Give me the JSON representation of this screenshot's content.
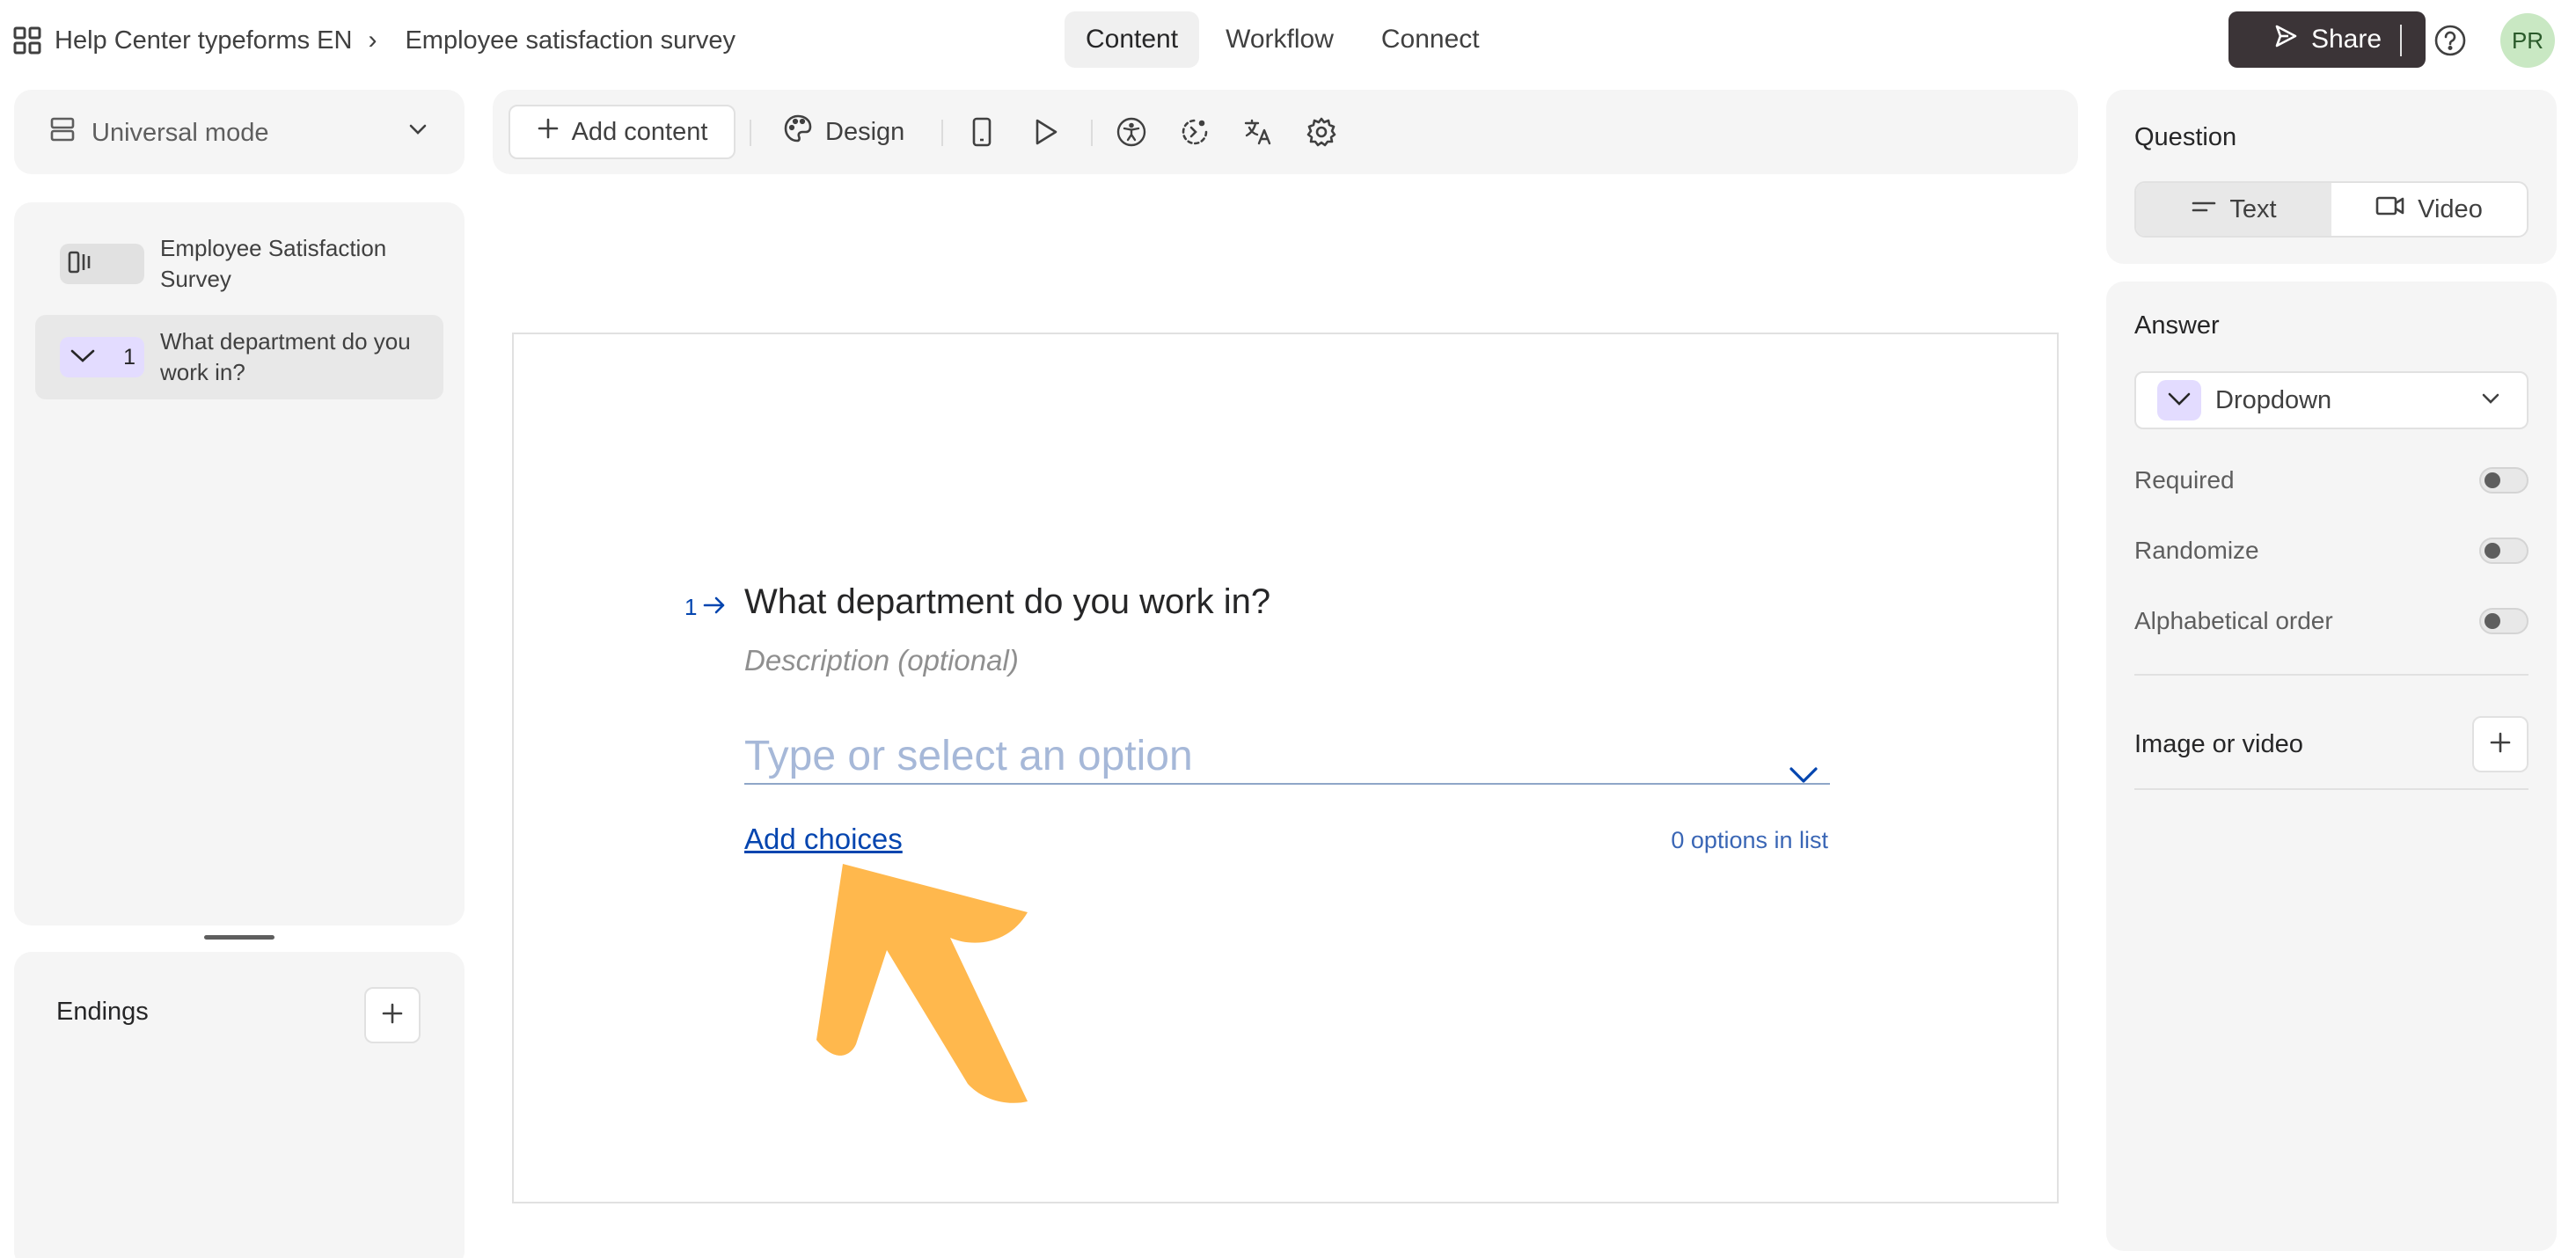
{
  "header": {
    "workspace": "Help Center typeforms EN",
    "form_name": "Employee satisfaction survey",
    "tabs": [
      {
        "label": "Content",
        "active": true
      },
      {
        "label": "Workflow",
        "active": false
      },
      {
        "label": "Connect",
        "active": false
      }
    ],
    "share_label": "Share",
    "avatar_initials": "PR"
  },
  "sidebar": {
    "mode_label": "Universal mode",
    "items": [
      {
        "label": "Employee Satisfaction Survey",
        "type": "welcome-screen",
        "icon": "welcome-screen-icon"
      },
      {
        "number": "1",
        "label": "What department do you work in?",
        "type": "dropdown",
        "icon": "chevron-down-icon",
        "selected": true
      }
    ],
    "endings_title": "Endings"
  },
  "toolbar": {
    "add_content_label": "Add content",
    "design_label": "Design",
    "icons": [
      "mobile-preview-icon",
      "play-icon",
      "accessibility-icon",
      "logic-icon",
      "translate-icon",
      "settings-icon"
    ]
  },
  "canvas": {
    "question_number": "1",
    "question_title": "What department do you work in?",
    "description_placeholder": "Description (optional)",
    "dropdown_placeholder": "Type or select an option",
    "add_choices_label": "Add choices",
    "options_count": "0 options in list"
  },
  "settings": {
    "question_title": "Question",
    "question_types": [
      {
        "label": "Text",
        "icon": "text-lines-icon",
        "active": true
      },
      {
        "label": "Video",
        "icon": "video-camera-icon",
        "active": false
      }
    ],
    "answer_title": "Answer",
    "answer_type": "Dropdown",
    "toggles": [
      {
        "label": "Required",
        "on": false
      },
      {
        "label": "Randomize",
        "on": false
      },
      {
        "label": "Alphabetical order",
        "on": false
      }
    ],
    "media_label": "Image or video"
  },
  "colors": {
    "accent_blue": "#0445af",
    "share_bg": "#3b3437",
    "dropdown_badge": "#e3dcff",
    "annotation_arrow": "#ffb84d",
    "avatar_bg": "#c9e8c3"
  }
}
